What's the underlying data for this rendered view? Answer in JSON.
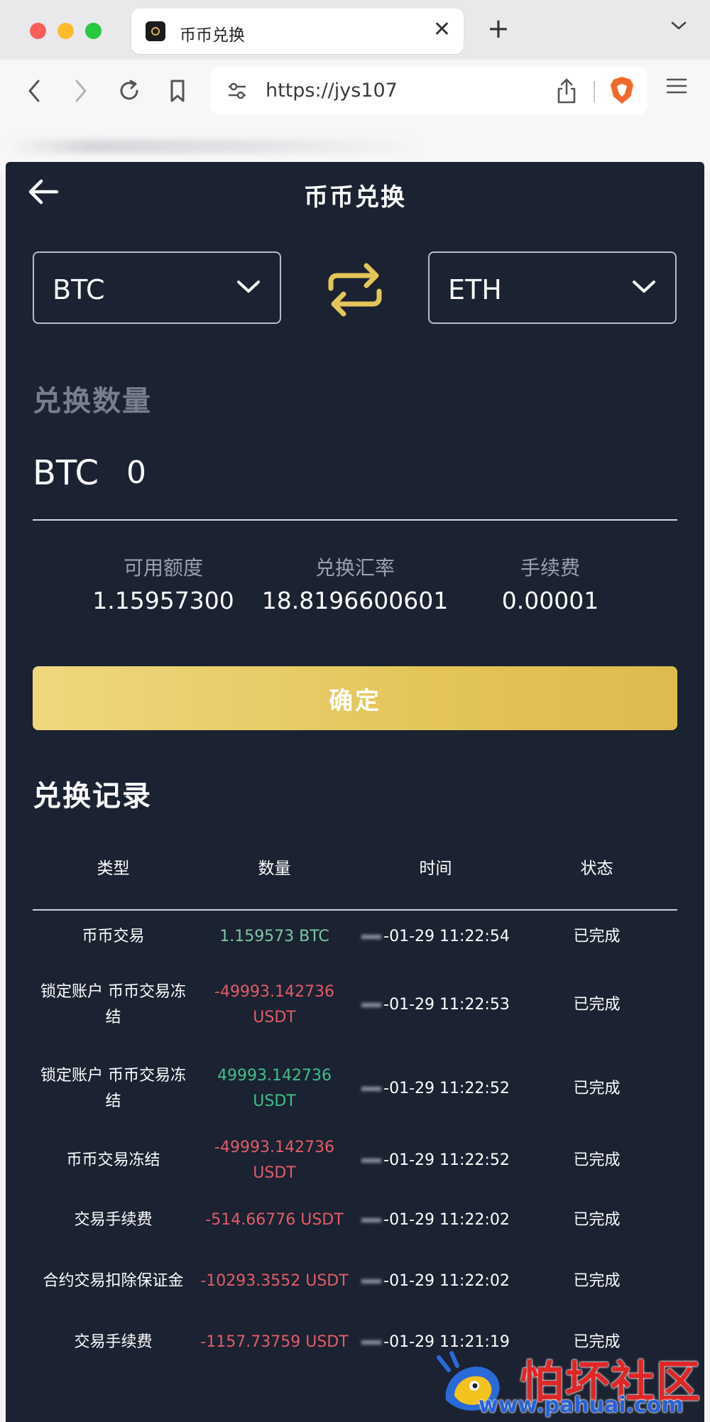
{
  "browser": {
    "tab_title": "币币兑换",
    "url": "https://jys107"
  },
  "page": {
    "title": "币币兑换",
    "from_coin": "BTC",
    "to_coin": "ETH",
    "amount_label": "兑换数量",
    "amount_coin": "BTC",
    "amount_value": "0",
    "stats": [
      {
        "label": "可用额度",
        "value": "1.15957300"
      },
      {
        "label": "兑换汇率",
        "value": "18.8196600601"
      },
      {
        "label": "手续费",
        "value": "0.00001"
      }
    ],
    "confirm_label": "确定",
    "records_title": "兑换记录",
    "table": {
      "headers": [
        "类型",
        "数量",
        "时间",
        "状态"
      ],
      "rows": [
        {
          "type": "币币交易",
          "amount": "1.159573 BTC",
          "time": "-01-29 11:22:54",
          "status": "已完成",
          "tone": "pos-muted"
        },
        {
          "type": "锁定账户 币币交易冻结",
          "amount": "-49993.142736 USDT",
          "time": "-01-29 11:22:53",
          "status": "已完成",
          "tone": "neg"
        },
        {
          "type": "锁定账户 币币交易冻结",
          "amount": "49993.142736 USDT",
          "time": "-01-29 11:22:52",
          "status": "已完成",
          "tone": "pos"
        },
        {
          "type": "币币交易冻结",
          "amount": "-49993.142736 USDT",
          "time": "-01-29 11:22:52",
          "status": "已完成",
          "tone": "neg"
        },
        {
          "type": "交易手续费",
          "amount": "-514.66776 USDT",
          "time": "-01-29 11:22:02",
          "status": "已完成",
          "tone": "neg"
        },
        {
          "type": "合约交易扣除保证金",
          "amount": "-10293.3552 USDT",
          "time": "-01-29 11:22:02",
          "status": "已完成",
          "tone": "neg"
        },
        {
          "type": "交易手续费",
          "amount": "-1157.73759 USDT",
          "time": "-01-29 11:21:19",
          "status": "已完成",
          "tone": "neg"
        }
      ]
    }
  },
  "watermark": {
    "big": "怕坏社区",
    "small": "www.pahuai.com"
  },
  "colors": {
    "page_bg": "#1b2231",
    "accent_gold": "#e4c55a",
    "positive": "#3ec08a",
    "negative": "#e25c68"
  }
}
